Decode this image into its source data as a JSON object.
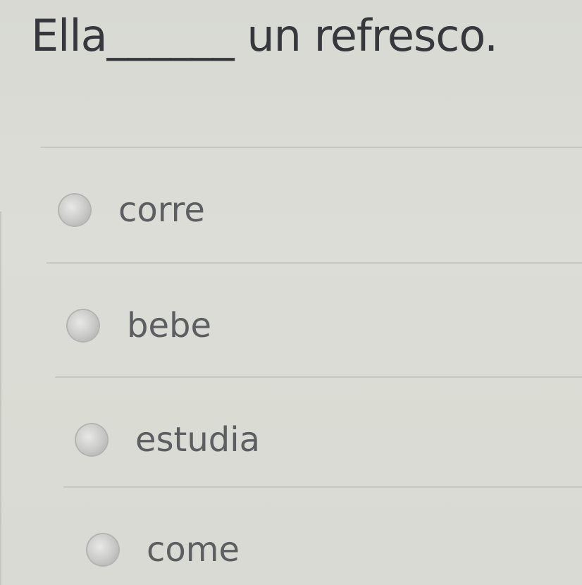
{
  "question": {
    "text": "Ella______ un refresco."
  },
  "options": [
    {
      "label": "corre"
    },
    {
      "label": "bebe"
    },
    {
      "label": "estudia"
    },
    {
      "label": "come"
    }
  ]
}
